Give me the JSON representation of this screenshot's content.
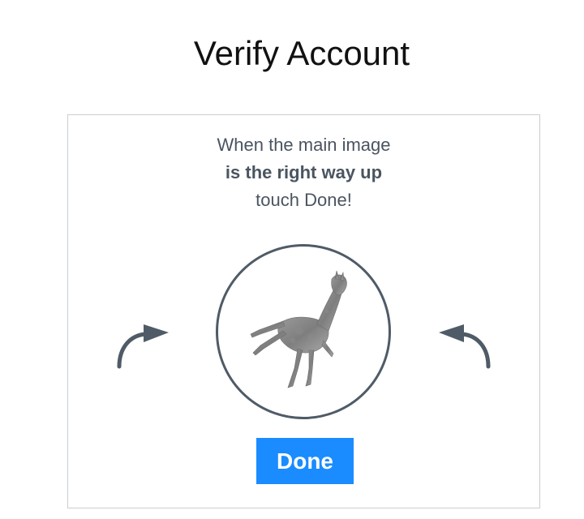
{
  "page": {
    "title": "Verify Account"
  },
  "challenge": {
    "instruction_line1": "When the main image",
    "instruction_line2": "is the right way up",
    "instruction_line3": "touch Done!",
    "main_image_icon": "giraffe-image",
    "rotate_left_icon": "rotate-left-arrow-icon",
    "rotate_right_icon": "rotate-right-arrow-icon",
    "done_label": "Done"
  },
  "colors": {
    "accent": "#1a8cff",
    "text": "#4a5561",
    "icon": "#4f5b67",
    "border": "#c9cdd2"
  }
}
